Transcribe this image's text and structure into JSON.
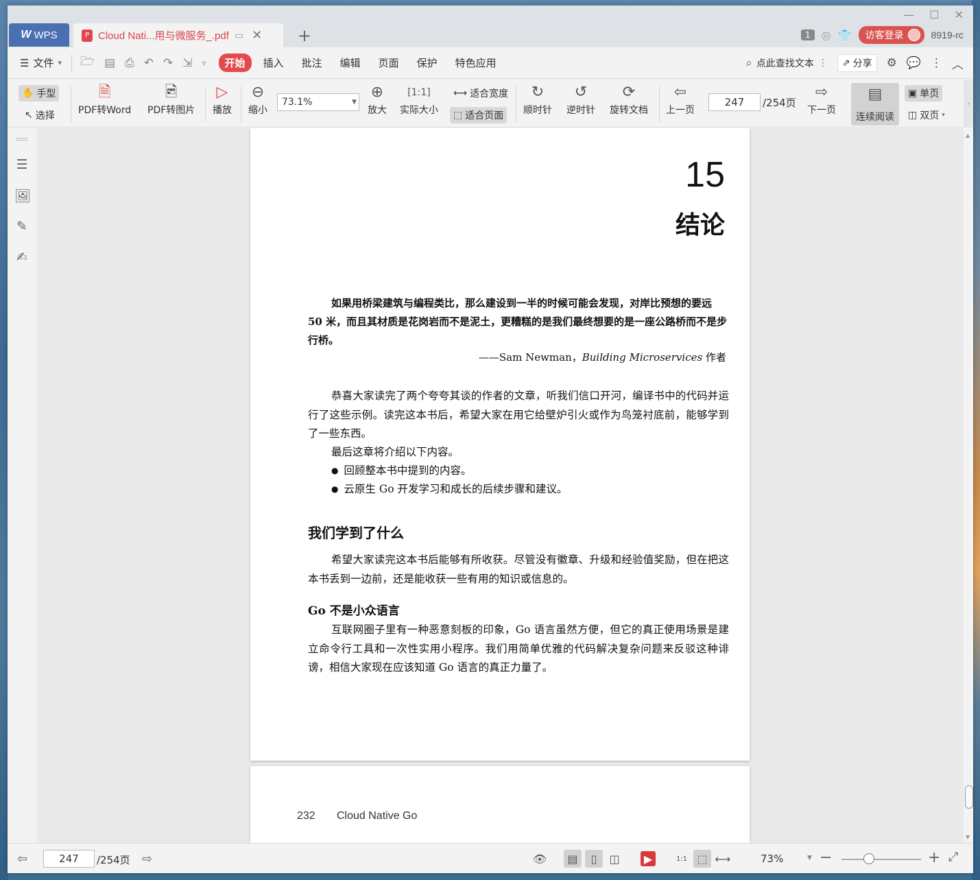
{
  "titlebar": {
    "app_tab": "WPS",
    "doc_tab_title": "Cloud Nati...用与微服务_.pdf",
    "page_badge": "1",
    "login_label": "访客登录",
    "version": "8919-rc"
  },
  "menubar": {
    "file_label": "文件",
    "tabs": [
      "开始",
      "插入",
      "批注",
      "编辑",
      "页面",
      "保护",
      "特色应用"
    ],
    "active_tab": "开始",
    "search_placeholder": "点此查找文本",
    "share_label": "分享"
  },
  "toolbar": {
    "hand_label": "手型",
    "select_label": "选择",
    "pdf_to_word": "PDF转Word",
    "pdf_to_image": "PDF转图片",
    "play": "播放",
    "zoom_out": "缩小",
    "zoom_value": "73.1%",
    "zoom_in": "放大",
    "actual_size": "实际大小",
    "fit_width": "适合宽度",
    "fit_page": "适合页面",
    "rotate_cw": "顺时针",
    "rotate_ccw": "逆时针",
    "rotate_doc": "旋转文档",
    "prev_page": "上一页",
    "current_page": "247",
    "total_pages": "/254页",
    "next_page": "下一页",
    "continuous_read": "连续阅读",
    "single_page": "单页",
    "double_page": "双页"
  },
  "document": {
    "chapter_number": "15",
    "chapter_title": "结论",
    "epigraph": "如果用桥梁建筑与编程类比，那么建设到一半的时候可能会发现，对岸比预想的要远 50 米，而且其材质是花岗岩而不是泥土，更糟糕的是我们最终想要的是一座公路桥而不是步行桥。",
    "epigraph_author_prefix": "——Sam Newman，",
    "epigraph_book": "Building Microservices",
    "epigraph_author_suffix": " 作者",
    "intro_para": "恭喜大家读完了两个夸夸其谈的作者的文章，听我们信口开河，编译书中的代码并运行了这些示例。读完这本书后，希望大家在用它给壁炉引火或作为鸟笼衬底前，能够学到了一些东西。",
    "intro_para2": "最后这章将介绍以下内容。",
    "bullets": [
      "回顾整本书中提到的内容。",
      "云原生 Go 开发学习和成长的后续步骤和建议。"
    ],
    "section_title": "我们学到了什么",
    "section_para": "希望大家读完这本书后能够有所收获。尽管没有徽章、升级和经验值奖励，但在把这本书丢到一边前，还是能收获一些有用的知识或信息的。",
    "subsection_title": "Go 不是小众语言",
    "subsection_para": "互联网圈子里有一种恶意刻板的印象，Go 语言虽然方便，但它的真正使用场景是建立命令行工具和一次性实用小程序。我们用简单优雅的代码解决复杂问题来反驳这种诽谤，相信大家现在应该知道 Go 语言的真正力量了。",
    "next_page_number": "232",
    "next_page_header": "Cloud Native Go"
  },
  "statusbar": {
    "current_page": "247",
    "total_pages": "/254页",
    "zoom": "73%"
  },
  "colors": {
    "accent_red": "#e34a4e",
    "wps_blue": "#4a6fb3"
  }
}
